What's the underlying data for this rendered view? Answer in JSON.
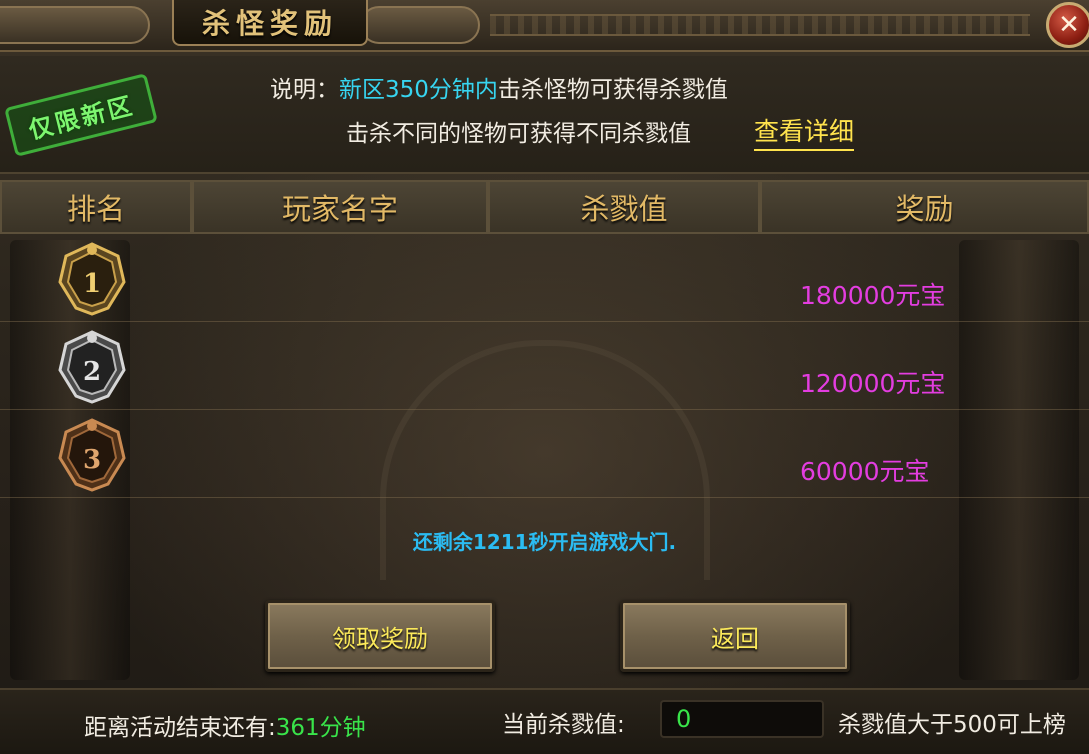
{
  "window": {
    "title": "杀怪奖励",
    "close_label": "✕"
  },
  "badge": {
    "new_zone_only": "仅限新区"
  },
  "info": {
    "prefix": "说明：",
    "highlight": "新区350分钟内",
    "line1_suffix": "击杀怪物可获得杀戮值",
    "line2": "击杀不同的怪物可获得不同杀戮值",
    "detail_link": "查看详细"
  },
  "table": {
    "headers": [
      "排名",
      "玩家名字",
      "杀戮值",
      "奖励"
    ],
    "rows": [
      {
        "rank": "1",
        "player": "",
        "kills": "",
        "reward": "180000元宝"
      },
      {
        "rank": "2",
        "player": "",
        "kills": "",
        "reward": "120000元宝"
      },
      {
        "rank": "3",
        "player": "",
        "kills": "",
        "reward": "60000元宝"
      }
    ]
  },
  "countdown_notice": "还剩余1211秒开启游戏大门.",
  "buttons": {
    "claim": "领取奖励",
    "back": "返回"
  },
  "footer": {
    "event_end_label": "距离活动结束还有:",
    "event_end_value": "361分钟",
    "current_kills_label": "当前杀戮值:",
    "current_kills_value": "0",
    "rank_threshold_note": "杀戮值大于500可上榜"
  },
  "colors": {
    "highlight_cyan": "#37d5f0",
    "link_yellow": "#ffe34d",
    "reward_magenta": "#e33de0",
    "notice_blue": "#2bbcf2",
    "green_value": "#39e44a",
    "header_gold": "#e2b966",
    "medal_gold": "#c9a04a",
    "medal_silver": "#b9b9b9",
    "medal_bronze": "#a0683a"
  },
  "icons": {
    "rank1": "gold-medal-icon",
    "rank2": "silver-medal-icon",
    "rank3": "bronze-medal-icon",
    "close": "close-icon"
  }
}
